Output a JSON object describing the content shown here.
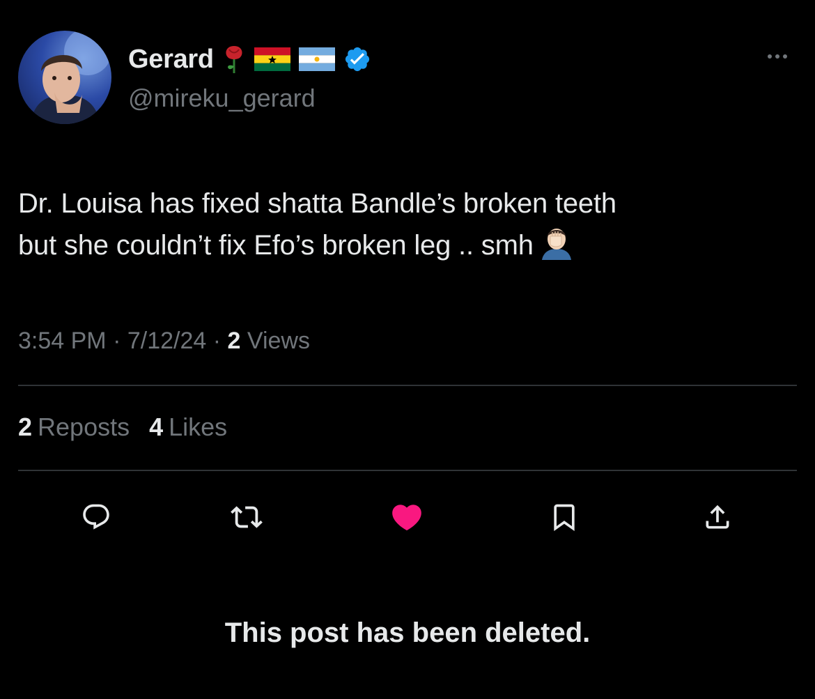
{
  "author": {
    "display_name": "Gerard",
    "handle": "@mireku_gerard",
    "badges": [
      "rose-icon",
      "ghana-flag-icon",
      "argentina-flag-icon",
      "verified-badge-icon"
    ]
  },
  "tweet": {
    "text_line1": "Dr. Louisa has fixed shatta Bandle’s broken teeth",
    "text_line2": "but she couldn’t fix Efo’s broken leg .. smh",
    "trailing_emoji": "facepalm-emoji-icon"
  },
  "meta": {
    "time": "3:54 PM",
    "separator": " · ",
    "date": "7/12/24",
    "views_count": "2",
    "views_label": "Views"
  },
  "stats": {
    "reposts_count": "2",
    "reposts_label": "Reposts",
    "likes_count": "4",
    "likes_label": "Likes"
  },
  "actions": [
    "reply-icon",
    "repost-icon",
    "like-icon",
    "bookmark-icon",
    "share-icon"
  ],
  "colors": {
    "background": "#000000",
    "text": "#e7e9ea",
    "secondary": "#71767b",
    "divider": "#2f3336",
    "like_active": "#f91880",
    "verified": "#1d9bf0"
  },
  "notice": "This post has been deleted."
}
